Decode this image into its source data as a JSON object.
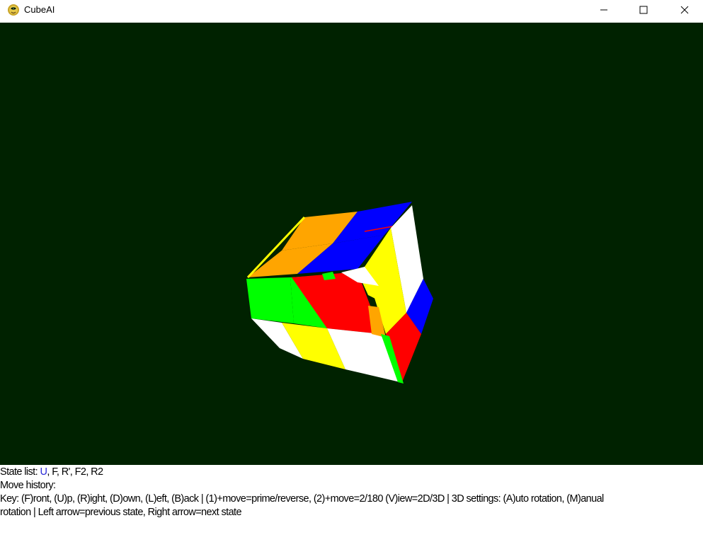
{
  "window": {
    "title": "CubeAI",
    "icon": "python-snake-icon",
    "controls": [
      "minimize",
      "maximize",
      "close"
    ]
  },
  "canvas": {
    "background": "#002200",
    "cube_colors": {
      "blue": "#0000ff",
      "orange": "#ffa500",
      "yellow": "#ffff00",
      "white": "#ffffff",
      "red": "#ff0000",
      "green": "#00ff00"
    }
  },
  "info": {
    "state_list_label": "State list: ",
    "state_current": "U",
    "state_rest": ", F, R', F2, R2",
    "move_history": "Move history:",
    "keys_line1": "Key: (F)ront, (U)p, (R)ight, (D)own, (L)eft, (B)ack | (1)+move=prime/reverse, (2)+move=2/180      (V)iew=2D/3D | 3D settings: (A)uto rotation, (M)anual",
    "keys_line2": "rotation | Left arrow=previous state, Right arrow=next state"
  }
}
